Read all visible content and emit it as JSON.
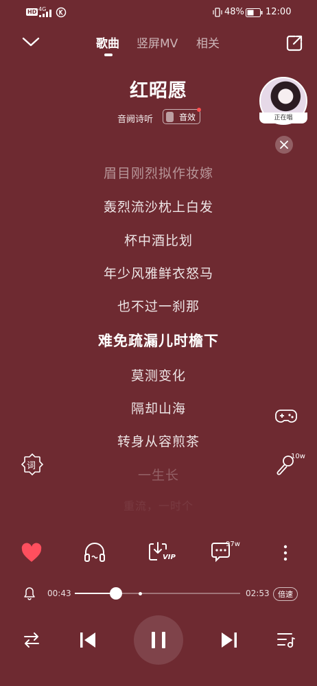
{
  "status_bar": {
    "hd": "HD",
    "network": "4G",
    "battery": "48%",
    "time": "12:00"
  },
  "header": {
    "tabs": [
      {
        "label": "歌曲",
        "active": true
      },
      {
        "label": "竖屏MV",
        "active": false
      },
      {
        "label": "相关",
        "active": false
      }
    ]
  },
  "song": {
    "title": "红昭愿",
    "artist": "音阙诗听",
    "effect_label": "音效",
    "cover_label": "正在唱"
  },
  "lyrics": {
    "lines": [
      "眉目刚烈拟作妆嫁",
      "轰烈流沙枕上白发",
      "杯中酒比划",
      "年少风雅鲜衣怒马",
      "也不过一刹那",
      "难免疏漏儿时檐下",
      "莫测变化",
      "隔却山海",
      "转身从容煎茶",
      "一生长",
      "重流，一时个"
    ],
    "current_index": 5
  },
  "side": {
    "lyric_badge": "词",
    "sing_count": "10w"
  },
  "actions": {
    "comment_count": "97w",
    "download_badge": "VIP"
  },
  "progress": {
    "elapsed": "00:43",
    "total": "02:53",
    "played_fraction": 0.25,
    "speed_label": "倍速"
  },
  "colors": {
    "background": "#6e2a31",
    "heart": "#ff4f5e"
  }
}
